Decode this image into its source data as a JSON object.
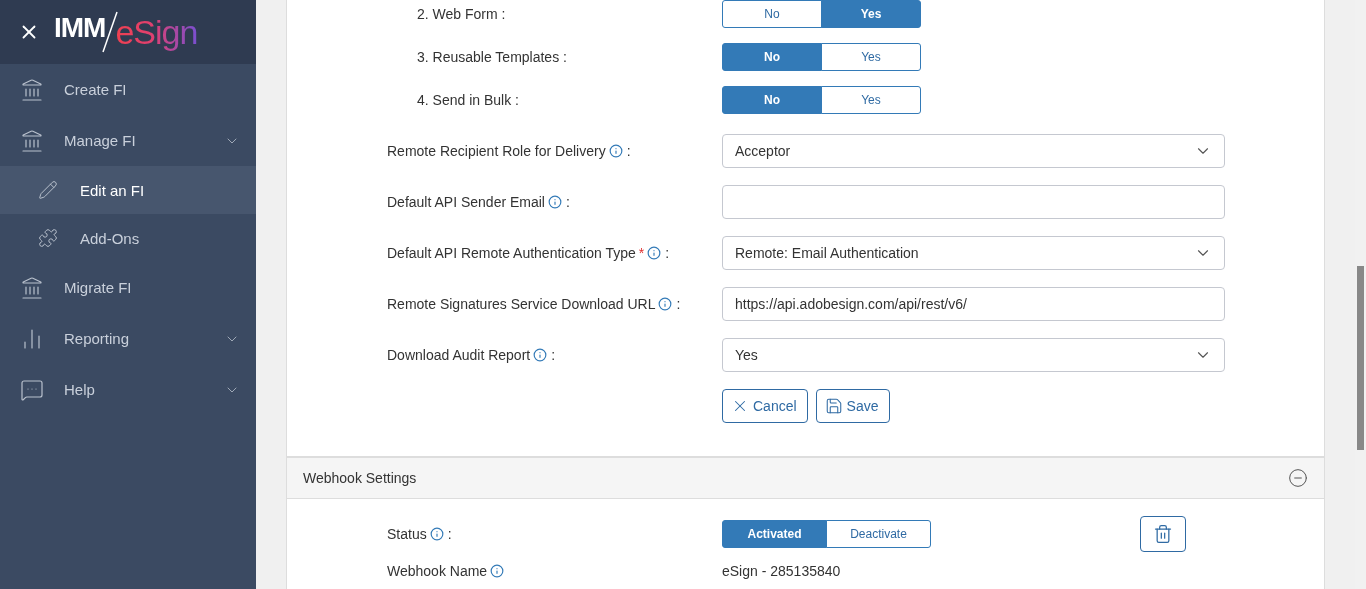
{
  "sidebar": {
    "logo": {
      "prefix": "IMM",
      "suffix": "eSign"
    },
    "items": [
      {
        "label": "Create FI",
        "selected": false,
        "expandable": false
      },
      {
        "label": "Manage FI",
        "selected": false,
        "expandable": true,
        "children": [
          {
            "label": "Edit an FI",
            "selected": true
          },
          {
            "label": "Add-Ons",
            "selected": false
          }
        ]
      },
      {
        "label": "Migrate FI",
        "selected": false,
        "expandable": false
      },
      {
        "label": "Reporting",
        "selected": false,
        "expandable": true
      },
      {
        "label": "Help",
        "selected": false,
        "expandable": true
      }
    ]
  },
  "features": [
    {
      "label": "2. Web Form :",
      "options": [
        {
          "label": "No",
          "selected": false
        },
        {
          "label": "Yes",
          "selected": true
        }
      ]
    },
    {
      "label": "3. Reusable Templates :",
      "options": [
        {
          "label": "No",
          "selected": true
        },
        {
          "label": "Yes",
          "selected": false
        }
      ]
    },
    {
      "label": "4. Send in Bulk :",
      "options": [
        {
          "label": "No",
          "selected": true
        },
        {
          "label": "Yes",
          "selected": false
        }
      ]
    }
  ],
  "fields": [
    {
      "kind": "select",
      "label": "Remote Recipient Role for Delivery",
      "colon": ":",
      "value": "Acceptor"
    },
    {
      "kind": "input",
      "label": "Default API Sender Email",
      "colon": ":"
    },
    {
      "kind": "select",
      "label": "Default API Remote Authentication Type",
      "required_mark": "*",
      "colon": ":",
      "value": "Remote: Email Authentication"
    },
    {
      "kind": "input",
      "label": "Remote Signatures Service Download URL",
      "colon": ":",
      "value": "https://api.adobesign.com/api/rest/v6/"
    },
    {
      "kind": "select",
      "label": "Download Audit Report",
      "colon": ":",
      "value": "Yes"
    }
  ],
  "actions": [
    {
      "kind": "cancel",
      "label": "Cancel"
    },
    {
      "kind": "save",
      "label": "Save"
    }
  ],
  "webhook": {
    "title": "Webhook Settings",
    "status": {
      "label": "Status",
      "colon": ":",
      "options": [
        {
          "label": "Activated",
          "selected": true
        },
        {
          "label": "Deactivate",
          "selected": false
        }
      ]
    },
    "name": {
      "label": "Webhook Name",
      "value": "eSign - 285135840"
    }
  }
}
